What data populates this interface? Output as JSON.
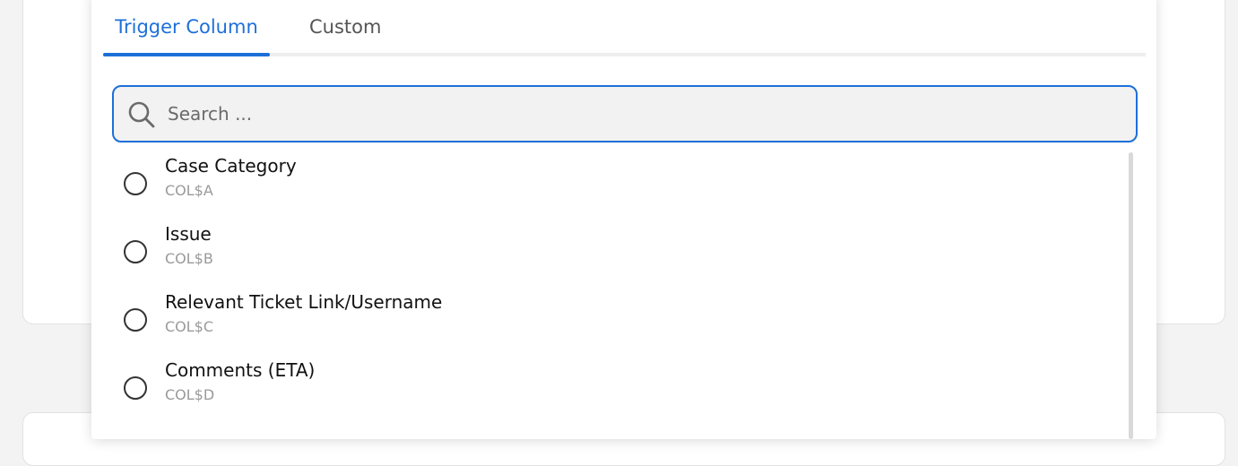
{
  "tabs": [
    {
      "label": "Trigger Column",
      "active": true
    },
    {
      "label": "Custom",
      "active": false
    }
  ],
  "search": {
    "placeholder": "Search ...",
    "value": ""
  },
  "columns": [
    {
      "label": "Case Category",
      "code": "COL$A"
    },
    {
      "label": "Issue",
      "code": "COL$B"
    },
    {
      "label": "Relevant Ticket Link/Username",
      "code": "COL$C"
    },
    {
      "label": "Comments (ETA)",
      "code": "COL$D"
    }
  ],
  "colors": {
    "accent": "#1d6fd8",
    "text": "#111111",
    "subtext": "#9a9a9a"
  },
  "icons": {
    "search": "search-icon"
  }
}
